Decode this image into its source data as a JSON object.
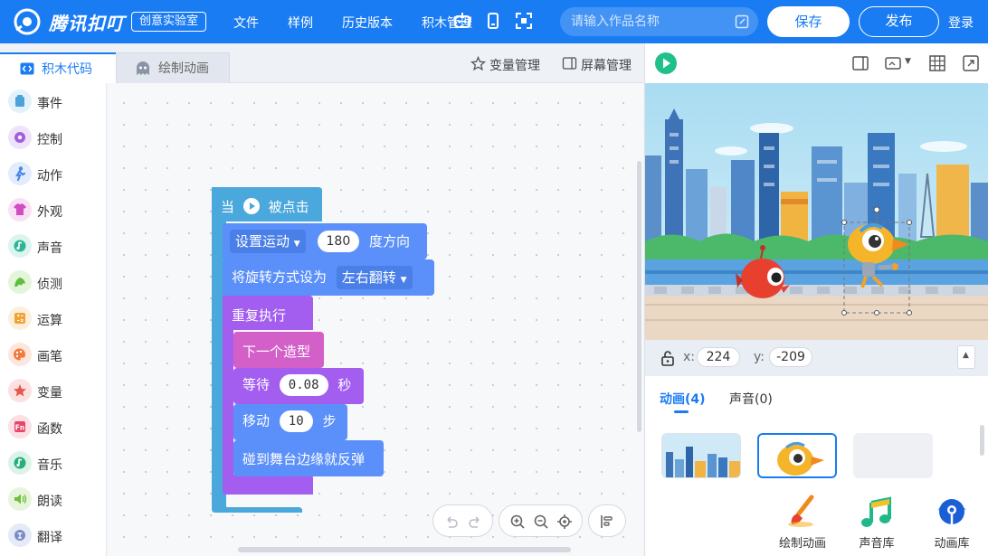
{
  "header": {
    "brand": "腾讯扣叮",
    "badge": "创意实验室",
    "menu": [
      "文件",
      "样例",
      "历史版本",
      "积木管理"
    ],
    "search_placeholder": "请输入作品名称",
    "save_label": "保存",
    "publish_label": "发布",
    "login_label": "登录"
  },
  "editor": {
    "tabs": [
      {
        "label": "积木代码",
        "icon": "code-icon",
        "active": true
      },
      {
        "label": "绘制动画",
        "icon": "ghost-icon",
        "active": false
      }
    ],
    "tools": [
      {
        "label": "变量管理",
        "icon": "star-icon"
      },
      {
        "label": "屏幕管理",
        "icon": "screen-icon"
      }
    ]
  },
  "categories": [
    {
      "label": "事件",
      "color": "#4ca3d8"
    },
    {
      "label": "控制",
      "color": "#a35ed9"
    },
    {
      "label": "动作",
      "color": "#4a86e8"
    },
    {
      "label": "外观",
      "color": "#d14dc2"
    },
    {
      "label": "声音",
      "color": "#2bb596"
    },
    {
      "label": "侦测",
      "color": "#5fbe3d"
    },
    {
      "label": "运算",
      "color": "#f2a233"
    },
    {
      "label": "画笔",
      "color": "#f07a3a"
    },
    {
      "label": "变量",
      "color": "#e8584f"
    },
    {
      "label": "函数",
      "color": "#e8456a"
    },
    {
      "label": "音乐",
      "color": "#24b07a"
    },
    {
      "label": "朗读",
      "color": "#6fc03c"
    },
    {
      "label": "翻译",
      "color": "#7a8cc8"
    }
  ],
  "script": {
    "hat": {
      "prefix": "当",
      "suffix": "被点击"
    },
    "set_motion": {
      "dropdown": "设置运动",
      "value": "180",
      "suffix": "度方向"
    },
    "rotation": {
      "label": "将旋转方式设为",
      "dropdown": "左右翻转"
    },
    "repeat": {
      "label": "重复执行"
    },
    "next_costume": {
      "label": "下一个造型"
    },
    "wait": {
      "label": "等待",
      "value": "0.08",
      "suffix": "秒"
    },
    "move": {
      "label": "移动",
      "value": "10",
      "suffix": "步"
    },
    "bounce": {
      "label": "碰到舞台边缘就反弹"
    }
  },
  "stage": {
    "x_label": "x:",
    "x_value": "224",
    "y_label": "y:",
    "y_value": "-209"
  },
  "asset_tabs": [
    {
      "label": "动画(4)",
      "active": true
    },
    {
      "label": "声音(0)",
      "active": false
    }
  ],
  "bottom_tools": [
    {
      "label": "绘制动画",
      "icon": "brush-icon"
    },
    {
      "label": "声音库",
      "icon": "music-note-icon"
    },
    {
      "label": "动画库",
      "icon": "sprite-library-icon"
    }
  ],
  "colors": {
    "brand_blue": "#1a7cf3",
    "event_block": "#4aa8dc",
    "motion_block": "#5b8ff9",
    "control_block": "#a35ef0",
    "looks_block": "#d35fc8"
  }
}
